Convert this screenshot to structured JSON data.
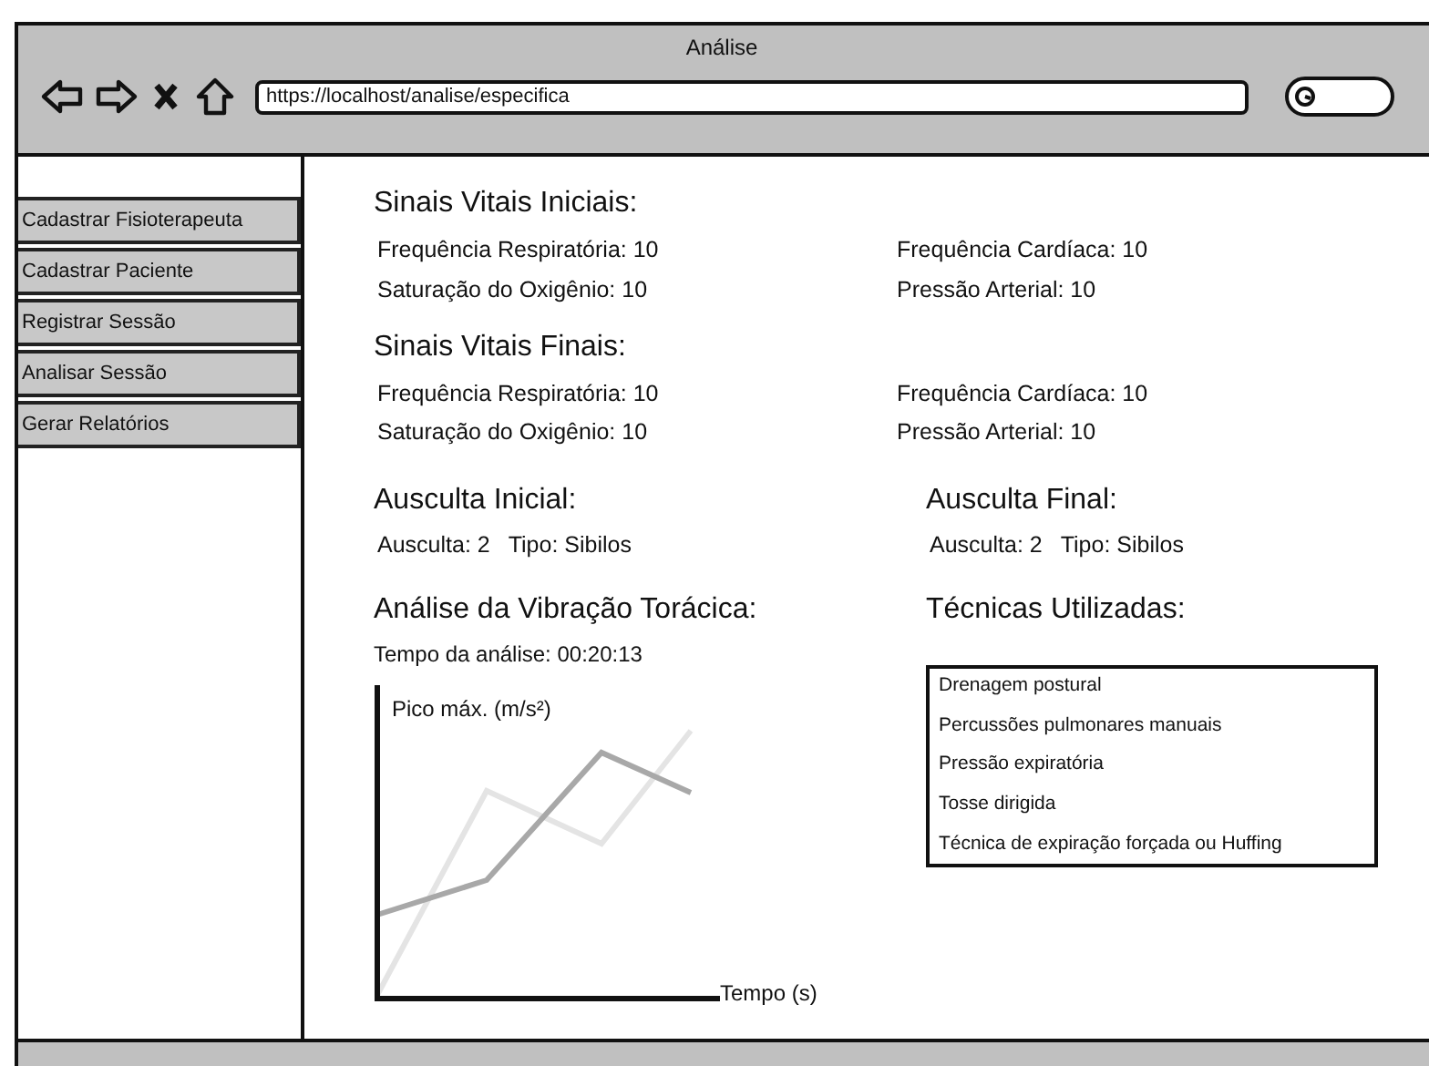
{
  "window": {
    "title": "Análise"
  },
  "browser": {
    "url": "https://localhost/analise/especifica"
  },
  "sidebar": {
    "items": [
      {
        "label": "Cadastrar Fisioterapeuta"
      },
      {
        "label": "Cadastrar Paciente"
      },
      {
        "label": "Registrar Sessão"
      },
      {
        "label": "Analisar Sessão"
      },
      {
        "label": "Gerar Relatórios"
      }
    ]
  },
  "vitals": [
    {
      "title": "Sinais Vitais Iniciais:",
      "fields": [
        "Frequência Respiratória: 10",
        "Frequência Cardíaca: 10",
        "Saturação do Oxigênio: 10",
        "Pressão Arterial: 10"
      ]
    },
    {
      "title": "Sinais Vitais Finais:",
      "fields": [
        "Frequência Respiratória: 10",
        "Frequência Cardíaca: 10",
        "Saturação do Oxigênio: 10",
        "Pressão Arterial: 10"
      ]
    }
  ],
  "auscultation": [
    {
      "title": "Ausculta Inicial:",
      "value": "Ausculta: 2",
      "type": "Tipo: Sibilos"
    },
    {
      "title": "Ausculta Final:",
      "value": "Ausculta: 2",
      "type": "Tipo: Sibilos"
    }
  ],
  "vibration": {
    "title": "Análise da Vibração Torácica:",
    "duration": "Tempo da análise: 00:20:13",
    "chart": {
      "ylabel": "Pico máx. (m/s²)",
      "xlabel": "Tempo (s)"
    }
  },
  "techniques": {
    "title": "Técnicas Utilizadas:",
    "items": [
      "Drenagem postural",
      "Percussões pulmonares manuais",
      "Pressão expiratória",
      "Tosse dirigida",
      "Técnica de expiração forçada ou Huffing"
    ]
  }
}
